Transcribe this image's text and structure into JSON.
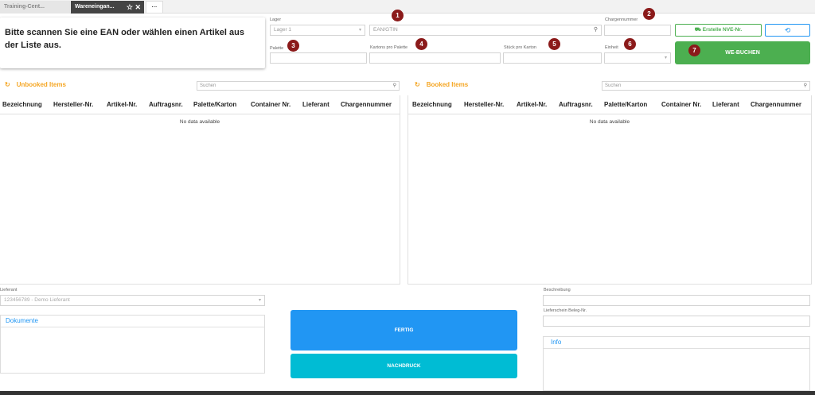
{
  "tabs": [
    {
      "label": "Training-Cent..."
    },
    {
      "label": "Wareneingan..."
    },
    {
      "label": "···"
    }
  ],
  "scan_message": "Bitte scannen Sie eine EAN oder wählen einen Artikel aus der Liste aus.",
  "form": {
    "lager_label": "Lager",
    "lager_value": "Lager 1",
    "ean_placeholder": "EAN/GTIN",
    "charge_label": "Chargennummer",
    "palette_label": "Palette",
    "kartons_label": "Kartons pro Palette",
    "stueck_label": "Stück pro Karton",
    "einheit_label": "Einheit"
  },
  "badges": [
    "1",
    "2",
    "3",
    "4",
    "5",
    "6",
    "7"
  ],
  "buttons": {
    "nve": "Erstelle NVE-Nr.",
    "we_buchen": "WE-BUCHEN",
    "fertig": "FERTIG",
    "nachdruck": "NACHDRUCK"
  },
  "unbooked": {
    "title": "Unbooked Items",
    "search_placeholder": "Suchen",
    "columns": [
      "Bezeichnung",
      "Hersteller-Nr.",
      "Artikel-Nr.",
      "Auftragsnr.",
      "Palette/Karton",
      "Container Nr.",
      "Lieferant",
      "Chargennummer"
    ],
    "empty": "No data available"
  },
  "booked": {
    "title": "Booked Items",
    "search_placeholder": "Suchen",
    "columns": [
      "Bezeichnung",
      "Hersteller-Nr.",
      "Artikel-Nr.",
      "Auftragsnr.",
      "Palette/Karton",
      "Container Nr.",
      "Lieferant",
      "Chargennummer"
    ],
    "empty": "No data available"
  },
  "lieferant": {
    "label": "Lieferant",
    "value": "123456789 - Demo Lieferant"
  },
  "dokumente_title": "Dokumente",
  "beschreibung_label": "Beschreibung",
  "lieferschein_label": "Lieferschein Beleg-Nr.",
  "info_title": "Info",
  "colors": {
    "accent_orange": "#f5a623",
    "green": "#4caf50",
    "blue": "#2196f3",
    "cyan": "#00bcd4",
    "badge": "#8b1a1a"
  }
}
